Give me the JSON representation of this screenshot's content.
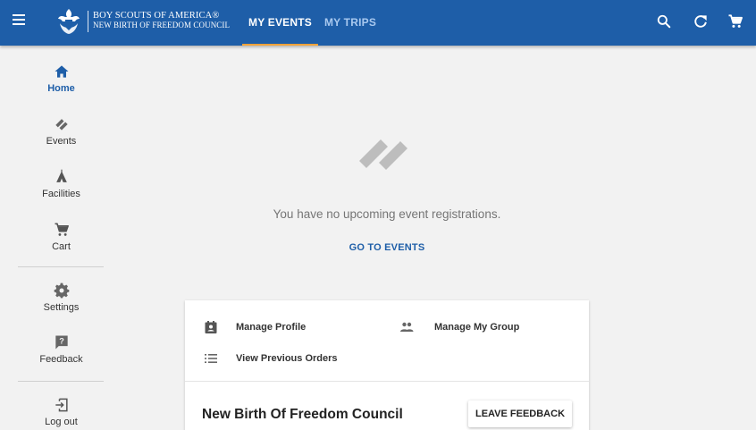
{
  "header": {
    "logo_line1": "BOY SCOUTS OF AMERICA®",
    "logo_line2": "NEW BIRTH OF FREEDOM COUNCIL",
    "tabs": [
      {
        "label": "MY EVENTS",
        "active": true
      },
      {
        "label": "MY TRIPS",
        "active": false
      }
    ],
    "icons": [
      "menu-icon",
      "search-icon",
      "refresh-icon",
      "cart-icon"
    ],
    "colors": {
      "bar": "#1e5ea8",
      "active_tab_underline": "#f2a23a"
    }
  },
  "sidebar": {
    "items": [
      {
        "label": "Home",
        "icon": "home-icon",
        "active": true
      },
      {
        "label": "Events",
        "icon": "tickets-icon",
        "active": false
      },
      {
        "label": "Facilities",
        "icon": "tent-icon",
        "active": false
      },
      {
        "label": "Cart",
        "icon": "cart-icon",
        "active": false
      },
      {
        "label": "Settings",
        "icon": "gear-icon",
        "active": false
      },
      {
        "label": "Feedback",
        "icon": "feedback-icon",
        "active": false
      },
      {
        "label": "Log out",
        "icon": "logout-icon",
        "active": false
      }
    ]
  },
  "main": {
    "empty_message": "You have no upcoming event registrations.",
    "go_to_events": "GO TO EVENTS"
  },
  "card": {
    "links": {
      "manage_profile": "Manage Profile",
      "manage_group": "Manage My Group",
      "previous_orders": "View Previous Orders"
    },
    "council_name": "New Birth Of Freedom Council",
    "leave_feedback": "LEAVE FEEDBACK"
  }
}
